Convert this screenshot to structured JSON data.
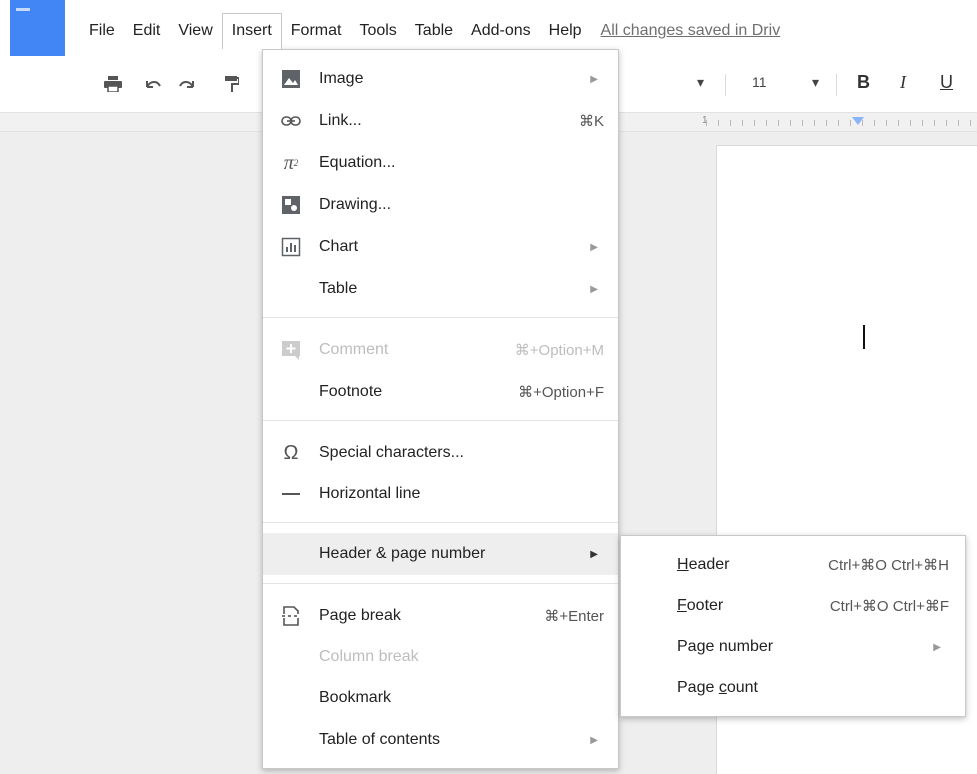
{
  "menubar": {
    "items": [
      "File",
      "Edit",
      "View",
      "Insert",
      "Format",
      "Tools",
      "Table",
      "Add-ons",
      "Help"
    ],
    "saved_status": "All changes saved in Driv"
  },
  "toolbar": {
    "icons": [
      "print-icon",
      "undo-icon",
      "redo-icon",
      "paint-format-icon"
    ],
    "font_size": "11",
    "bold": "B",
    "italic": "I",
    "underline": "U"
  },
  "ruler": {
    "label": "1"
  },
  "insert_menu": {
    "items": [
      {
        "label": "Image",
        "shortcut": "",
        "icon": "image-icon",
        "submenu": true,
        "disabled": false
      },
      {
        "label": "Link...",
        "shortcut": "⌘K",
        "icon": "link-icon",
        "submenu": false,
        "disabled": false
      },
      {
        "label": "Equation...",
        "shortcut": "",
        "icon": "pi-icon",
        "submenu": false,
        "disabled": false
      },
      {
        "label": "Drawing...",
        "shortcut": "",
        "icon": "drawing-icon",
        "submenu": false,
        "disabled": false
      },
      {
        "label": "Chart",
        "shortcut": "",
        "icon": "chart-icon",
        "submenu": true,
        "disabled": false
      },
      {
        "label": "Table",
        "shortcut": "",
        "icon": "",
        "submenu": true,
        "disabled": false
      },
      {
        "label": "Comment",
        "shortcut": "⌘+Option+M",
        "icon": "comment-icon",
        "submenu": false,
        "disabled": true
      },
      {
        "label": "Footnote",
        "shortcut": "⌘+Option+F",
        "icon": "",
        "submenu": false,
        "disabled": false
      },
      {
        "label": "Special characters...",
        "shortcut": "",
        "icon": "omega-icon",
        "submenu": false,
        "disabled": false
      },
      {
        "label": "Horizontal line",
        "shortcut": "",
        "icon": "horizontal-line-icon",
        "submenu": false,
        "disabled": false
      },
      {
        "label": "Header & page number",
        "shortcut": "",
        "icon": "",
        "submenu": true,
        "disabled": false
      },
      {
        "label": "Page break",
        "shortcut": "⌘+Enter",
        "icon": "page-break-icon",
        "submenu": false,
        "disabled": false
      },
      {
        "label": "Column break",
        "shortcut": "",
        "icon": "",
        "submenu": false,
        "disabled": true
      },
      {
        "label": "Bookmark",
        "shortcut": "",
        "icon": "",
        "submenu": false,
        "disabled": false
      },
      {
        "label": "Table of contents",
        "shortcut": "",
        "icon": "",
        "submenu": true,
        "disabled": false
      }
    ]
  },
  "header_submenu": {
    "items": [
      {
        "label_pre": "",
        "label_u": "H",
        "label_post": "eader",
        "shortcut": "Ctrl+⌘O Ctrl+⌘H",
        "submenu": false
      },
      {
        "label_pre": "",
        "label_u": "F",
        "label_post": "ooter",
        "shortcut": "Ctrl+⌘O Ctrl+⌘F",
        "submenu": false
      },
      {
        "label_pre": "Pa",
        "label_u": "g",
        "label_post": "e number",
        "shortcut": "",
        "submenu": true
      },
      {
        "label_pre": "Page ",
        "label_u": "c",
        "label_post": "ount",
        "shortcut": "",
        "submenu": false
      }
    ]
  }
}
